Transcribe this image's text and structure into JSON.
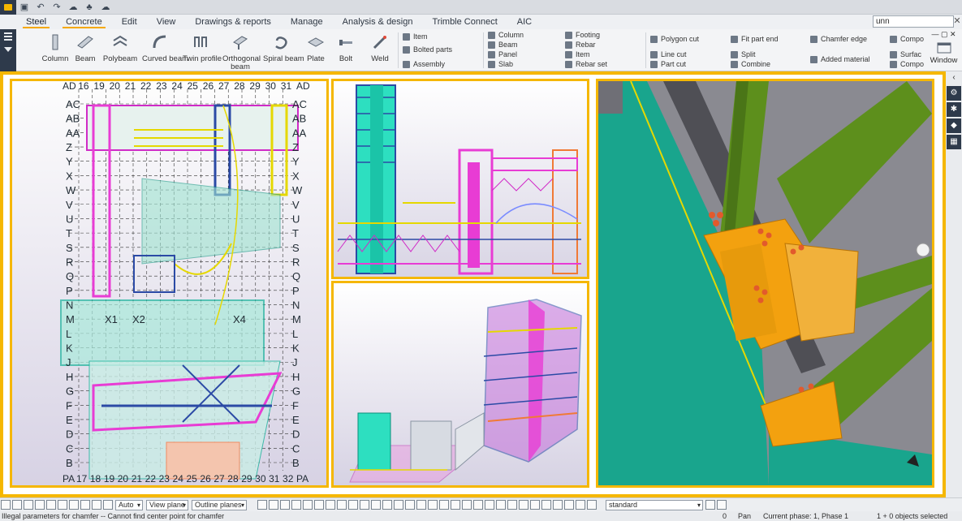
{
  "quick_access": {
    "buttons": [
      "save-icon",
      "undo-icon",
      "redo-icon",
      "cloud-icon",
      "tree-icon",
      "cloud-sync-icon"
    ]
  },
  "tabs": [
    {
      "label": "Steel",
      "active": true
    },
    {
      "label": "Concrete",
      "active": false,
      "accent": true
    },
    {
      "label": "Edit",
      "active": false
    },
    {
      "label": "View",
      "active": false
    },
    {
      "label": "Drawings & reports",
      "active": false
    },
    {
      "label": "Manage",
      "active": false
    },
    {
      "label": "Analysis & design",
      "active": false
    },
    {
      "label": "Trimble Connect",
      "active": false
    },
    {
      "label": "AIC",
      "active": false
    }
  ],
  "search": {
    "value": "unn",
    "clear": "✕"
  },
  "ribbon": {
    "steel_buttons": [
      "Column",
      "Beam",
      "Polybeam",
      "Curved beam",
      "Twin profile",
      "Orthogonal beam",
      "Spiral beam",
      "Plate",
      "Bolt",
      "Weld"
    ],
    "group1": [
      "Item",
      "Bolted parts",
      "Assembly"
    ],
    "concrete_col1": [
      "Column",
      "Beam",
      "Panel",
      "Slab"
    ],
    "concrete_col2": [
      "Footing",
      "Rebar",
      "Item",
      "Rebar set"
    ],
    "edit_col1": [
      "Polygon cut",
      "Line cut",
      "Part cut"
    ],
    "edit_col2": [
      "Fit part end",
      "Split",
      "Combine"
    ],
    "edit_col3": [
      "Chamfer edge",
      "Added material"
    ],
    "edit_col4": [
      "Compo",
      "Surfac",
      "Compo"
    ],
    "window_label": "Window"
  },
  "view1": {
    "top_labels": [
      "AD",
      "16",
      "19",
      "20",
      "21",
      "22",
      "23",
      "24",
      "25",
      "26",
      "27",
      "28",
      "29",
      "30",
      "31",
      "AD"
    ],
    "bottom_labels": [
      "PA",
      "17",
      "18",
      "19",
      "20",
      "21",
      "22",
      "23",
      "24",
      "25",
      "26",
      "27",
      "28",
      "29",
      "30",
      "31",
      "32",
      "PA"
    ],
    "row_labels": [
      "AC",
      "AB",
      "AA",
      "Z",
      "Y",
      "X",
      "W",
      "V",
      "U",
      "T",
      "S",
      "R",
      "Q",
      "P",
      "N",
      "M",
      "L",
      "K",
      "J",
      "H",
      "G",
      "F",
      "E",
      "D",
      "C",
      "B"
    ],
    "markers": [
      "X1",
      "X2",
      "X4"
    ]
  },
  "bottom_toolbar": {
    "select1": "Auto",
    "select2": "View plane",
    "select3": "Outline planes",
    "select4": "standard"
  },
  "status": {
    "message": "Illegal parameters for chamfer -- Cannot find center point for chamfer",
    "count": "0",
    "mode": "Pan",
    "phase": "Current phase: 1, Phase 1",
    "selection": "1 + 0 objects selected"
  },
  "colors": {
    "accent": "#f5b700",
    "dark": "#2e3a4b",
    "green_member": "#5d8f1c",
    "orange_plate": "#f3a10f",
    "teal_slab": "#19b39b"
  }
}
